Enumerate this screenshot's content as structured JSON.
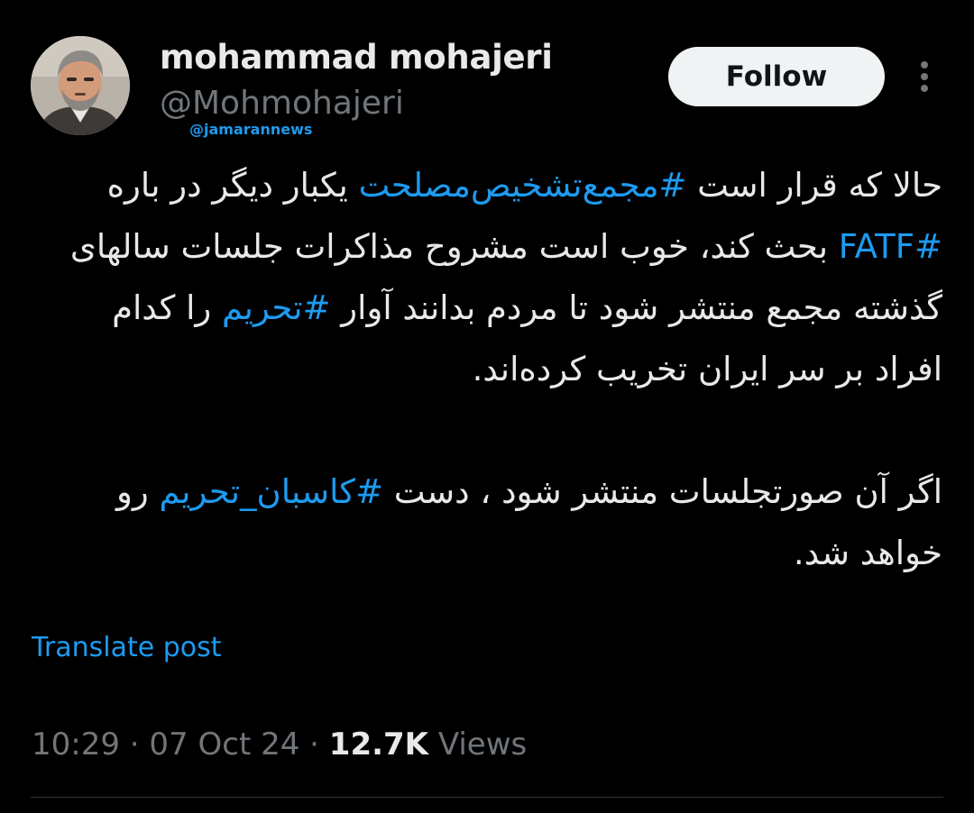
{
  "author": {
    "name": "mohammad mohajeri",
    "handle": "@Mohmohajeri"
  },
  "watermark": "@jamarannews",
  "follow_label": "Follow",
  "more_icon": "more-vertical-icon",
  "tweet": {
    "p1_a": "حالا که قرار است ",
    "hashtag1": "#مجمع‌تشخیص‌مصلحت",
    "p1_b": " یکبار دیگر در باره ",
    "hashtag2": "#FATF",
    "p1_c": " بحث کند، خوب است مشروح مذاکرات جلسات سالهای گذشته مجمع منتشر شود تا مردم بدانند آوار ",
    "hashtag3": "#تحریم",
    "p1_d": " را کدام افراد بر سر ایران تخریب کرده‌اند.",
    "p2_a": "اگر آن صورتجلسات منتشر شود ، دست ",
    "hashtag4": "#کاسبان_تحریم",
    "p2_b": " رو خواهد شد."
  },
  "translate_label": "Translate post",
  "meta": {
    "time": "10:29",
    "sep1": " · ",
    "date": "07 Oct 24",
    "sep2": " · ",
    "views_count": "12.7K",
    "views_label": " Views"
  },
  "colors": {
    "background": "#000000",
    "text": "#e7e9ea",
    "muted": "#71767b",
    "link": "#1d9bf0",
    "button_bg": "#eff3f4"
  }
}
